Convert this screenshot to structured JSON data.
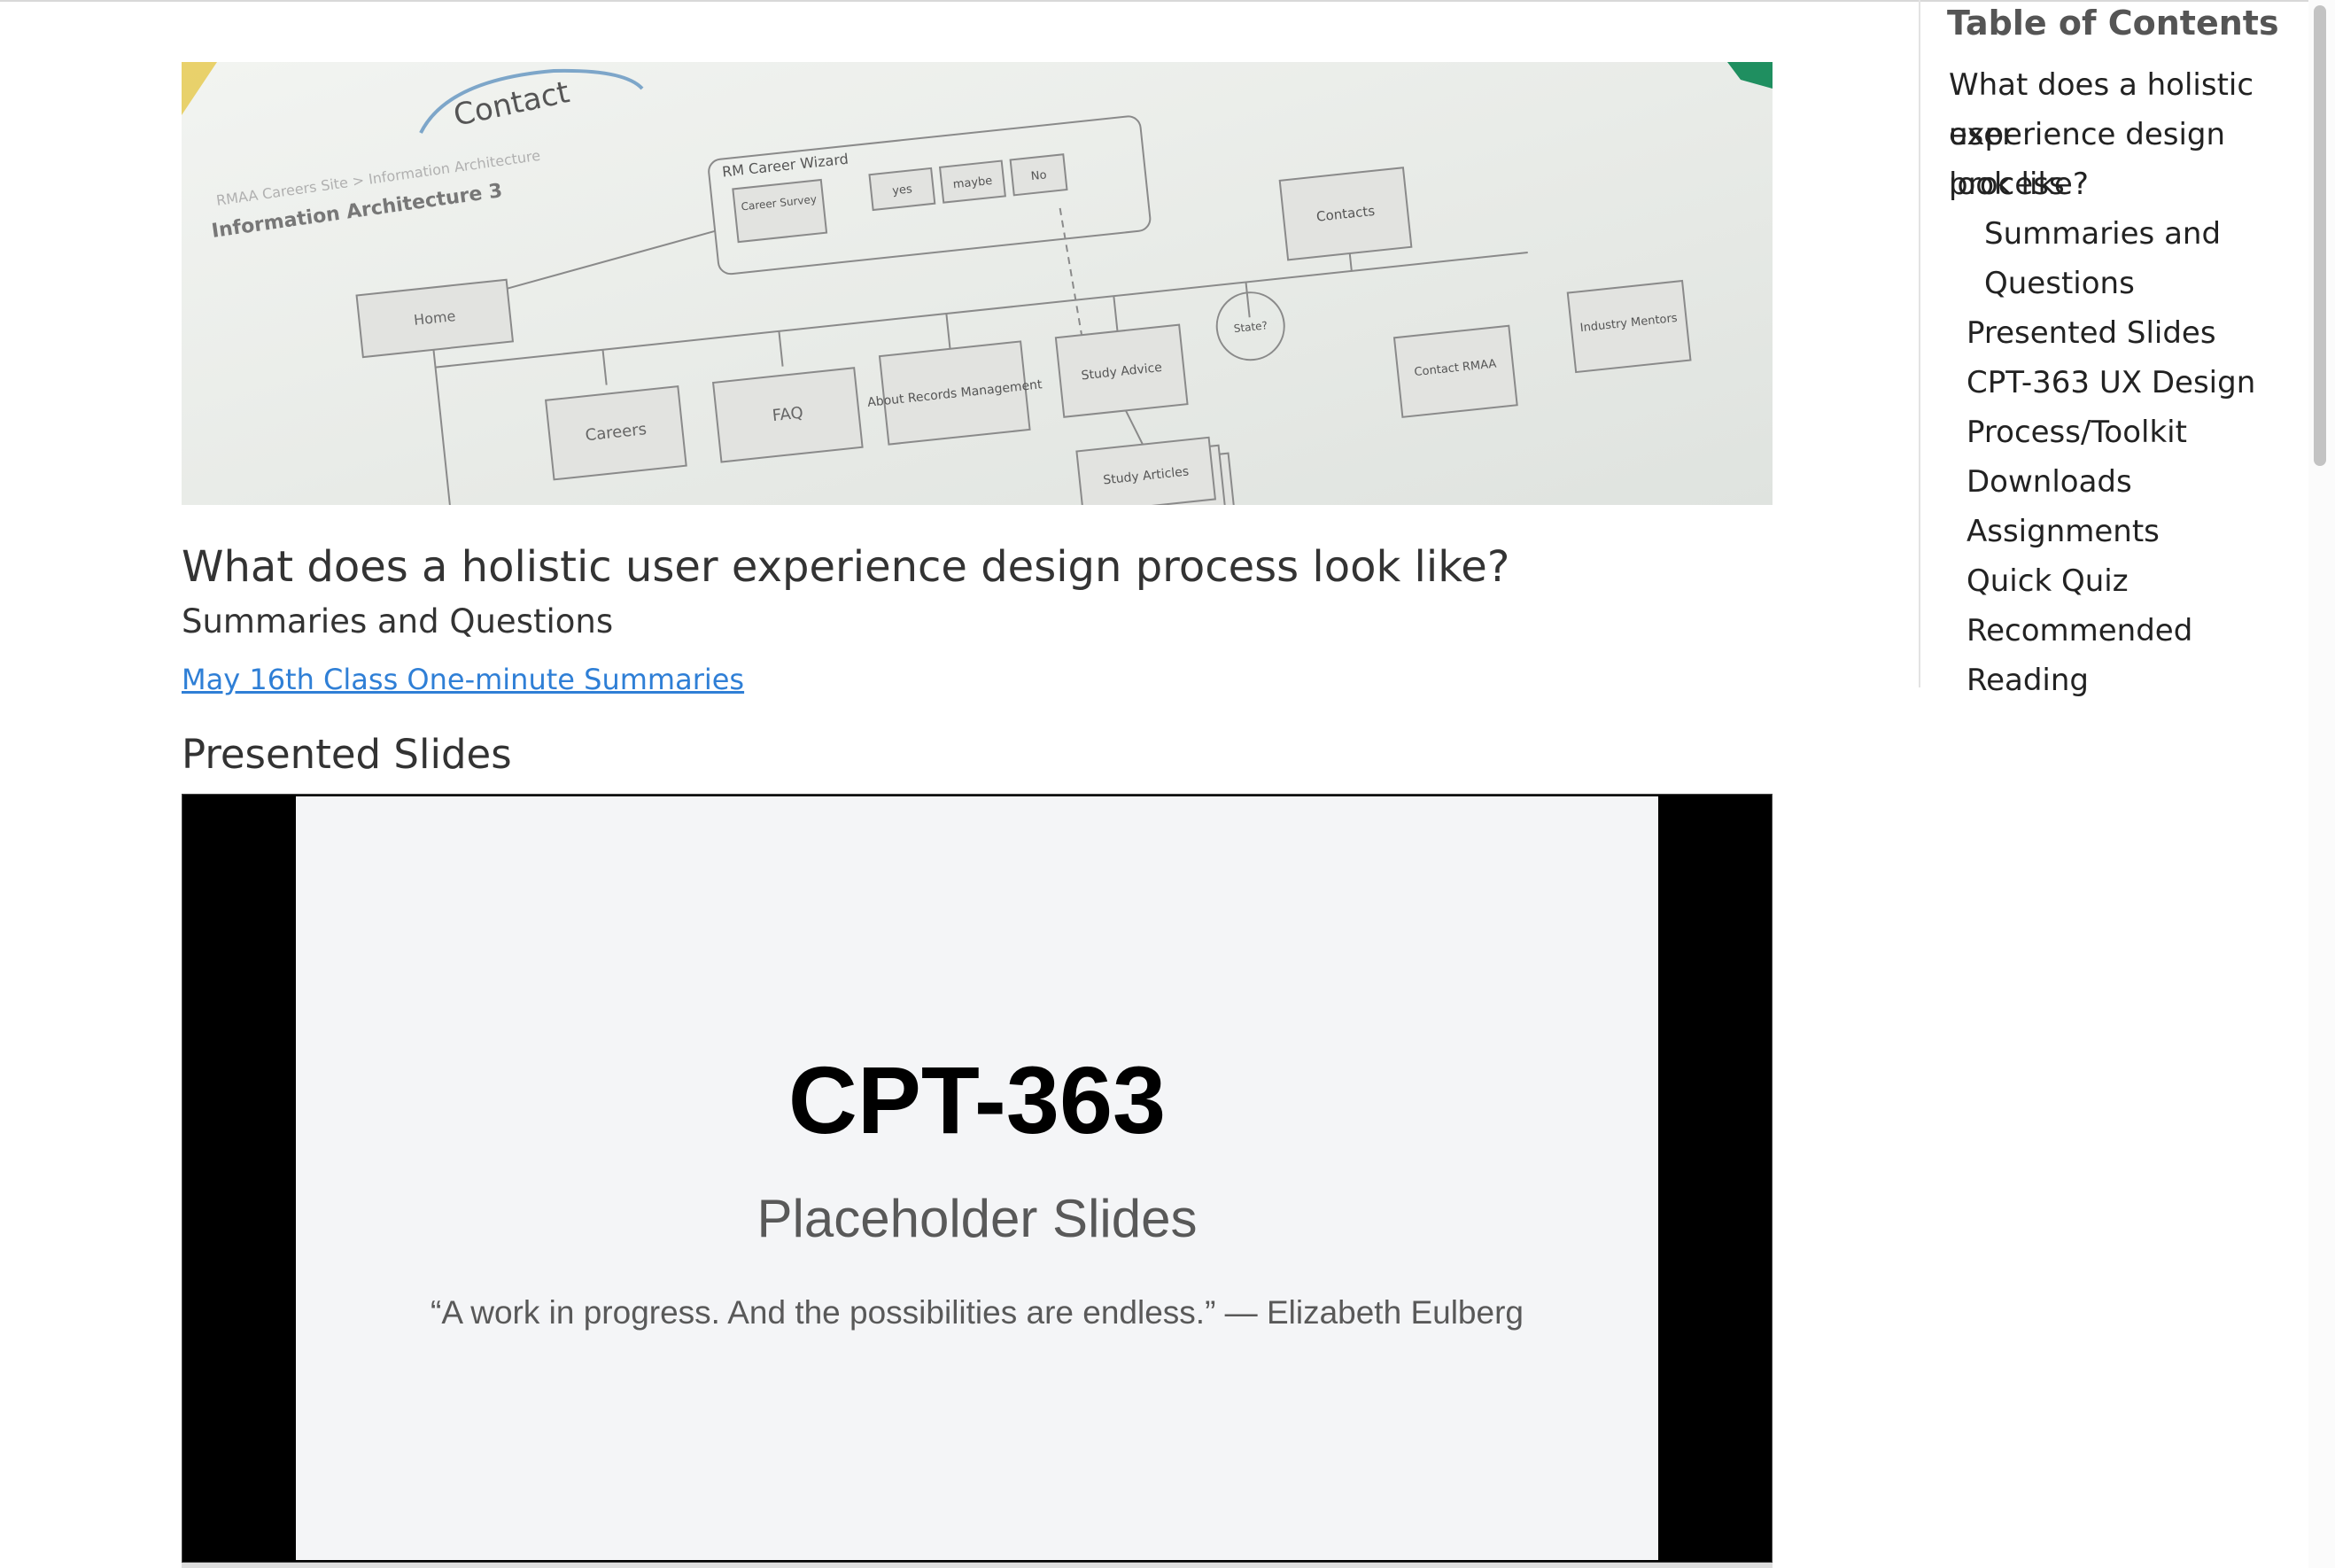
{
  "hero": {
    "doc_heading": "Information Architecture 3",
    "doc_breadcrumb": "RMAA Careers Site  >  Information Architecture",
    "scribble": "Contact",
    "wizard_label": "RM Career Wizard",
    "nodes": {
      "home": "Home",
      "career_survey": "Career Survey",
      "yes": "yes",
      "maybe": "maybe",
      "no": "No",
      "careers": "Careers",
      "faq": "FAQ",
      "about": "About Records Management",
      "study_advice": "Study Advice",
      "state": "State?",
      "contacts": "Contacts",
      "contact_rmaa": "Contact RMAA",
      "industry": "Industry Mentors",
      "study_articles": "Study Articles"
    }
  },
  "main": {
    "title": "What does a holistic user experience design process look like?",
    "subtitle": "Summaries and Questions",
    "summary_link": "May 16th Class One-minute Summaries",
    "presented_slides_heading": "Presented Slides"
  },
  "slide": {
    "title": "CPT-363",
    "subtitle": "Placeholder Slides",
    "quote": "“A work in progress. And the possibilities are endless.” — Elizabeth Eulberg"
  },
  "toc": {
    "heading": "Table of Contents",
    "items": {
      "holistic_line1": "What does a holistic user",
      "holistic_line2": "experience design process",
      "holistic_line3": "look like?",
      "summaries_line1": "Summaries and",
      "summaries_line2": "Questions",
      "presented_slides": "Presented Slides",
      "cpt_line1": "CPT-363 UX Design",
      "cpt_line2": "Process/Toolkit",
      "downloads": "Downloads",
      "assignments": "Assignments",
      "quick_quiz": "Quick Quiz",
      "recommended_reading": "Recommended Reading"
    }
  },
  "colors": {
    "link": "#2f7fd6",
    "slide_background": "#f4f5f7",
    "embed_frame": "#000000"
  }
}
